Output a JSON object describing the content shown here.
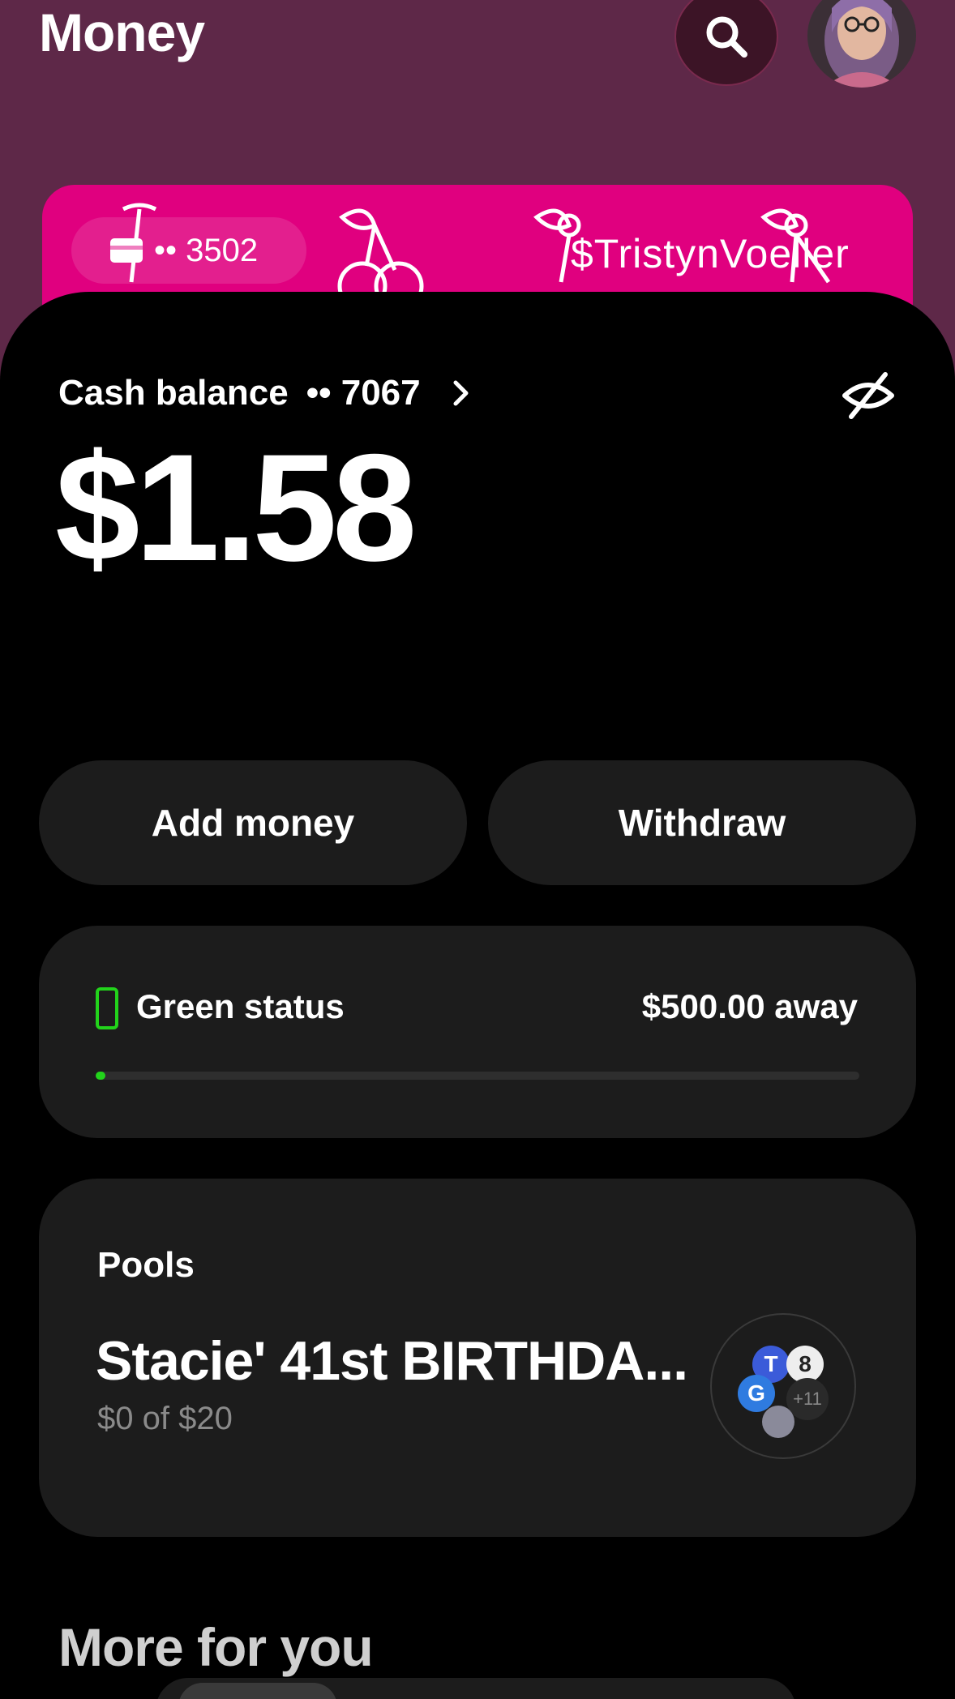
{
  "header": {
    "title": "Money",
    "search_icon": "search-icon",
    "avatar_icon": "profile-avatar"
  },
  "card": {
    "last_digits": "•• 3502",
    "cashtag": "$TristynVoeller",
    "color": "#e0007f"
  },
  "balance": {
    "label": "Cash balance",
    "account": "•• 7067",
    "amount": "$1.58",
    "hide_icon": "eye-off-icon"
  },
  "actions": {
    "add_money": "Add money",
    "withdraw": "Withdraw"
  },
  "status": {
    "label": "Green status",
    "away": "$500.00 away",
    "progress_fraction": 0.01,
    "accent": "#22d31b"
  },
  "pools": {
    "heading": "Pools",
    "name": "Stacie' 41st BIRTHDA...",
    "progress": "$0 of $20",
    "members": [
      {
        "initial": "T",
        "color": "#3b5bd9"
      },
      {
        "initial": "8",
        "color": "#eeeeee"
      },
      {
        "initial": "G",
        "color": "#2f7be0"
      }
    ],
    "more_count": "+11"
  },
  "more": {
    "heading": "More for you"
  }
}
